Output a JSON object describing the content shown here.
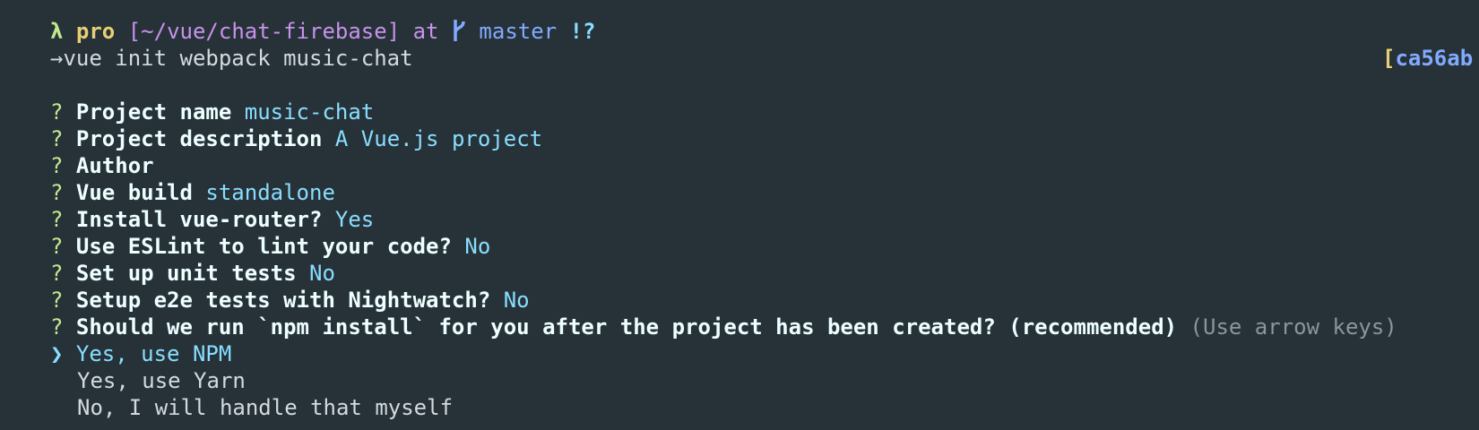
{
  "prompt": {
    "lambda": "λ",
    "user": "pro",
    "path": "[~/vue/chat-firebase]",
    "at": "at",
    "branch": "master",
    "status": "!?",
    "arrow": "→",
    "command": "vue init webpack music-chat",
    "rprompt_bracket": "[",
    "rprompt_hash": "ca56ab"
  },
  "questions": [
    {
      "mark": "?",
      "label": "Project name",
      "answer": "music-chat"
    },
    {
      "mark": "?",
      "label": "Project description",
      "answer": "A Vue.js project"
    },
    {
      "mark": "?",
      "label": "Author",
      "answer": ""
    },
    {
      "mark": "?",
      "label": "Vue build",
      "answer": "standalone"
    },
    {
      "mark": "?",
      "label": "Install vue-router?",
      "answer": "Yes"
    },
    {
      "mark": "?",
      "label": "Use ESLint to lint your code?",
      "answer": "No"
    },
    {
      "mark": "?",
      "label": "Set up unit tests",
      "answer": "No"
    },
    {
      "mark": "?",
      "label": "Setup e2e tests with Nightwatch?",
      "answer": "No"
    },
    {
      "mark": "?",
      "label": "Should we run `npm install` for you after the project has been created? (recommended)",
      "hint": "(Use arrow keys)"
    }
  ],
  "menu": {
    "pointer": "❯",
    "options": [
      "Yes, use NPM",
      "Yes, use Yarn",
      "No, I will handle that myself"
    ]
  },
  "colors": {
    "background": "#263238",
    "accent_cyan": "#89ddff",
    "accent_green": "#c3e88d",
    "accent_purple": "#c792ea",
    "accent_yellow": "#e8cf73",
    "accent_blue": "#82aaff"
  }
}
